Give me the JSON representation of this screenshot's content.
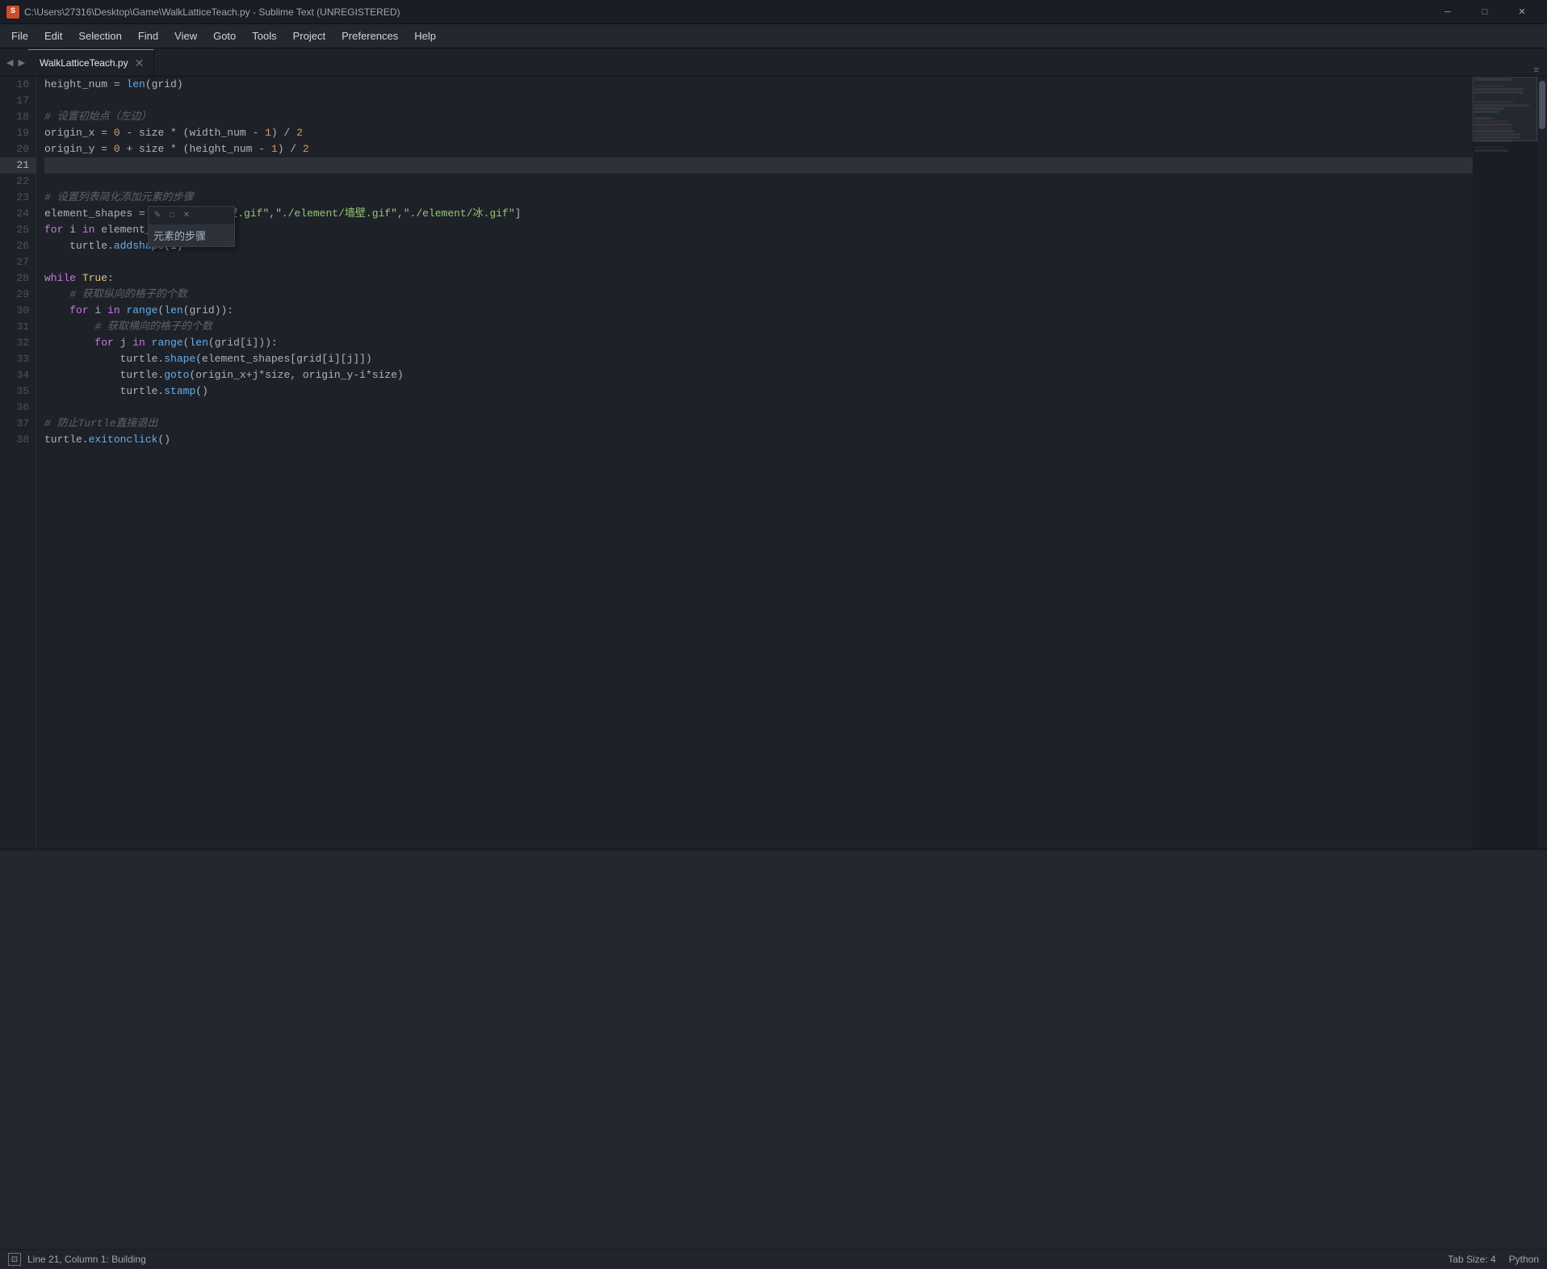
{
  "titlebar": {
    "title": "C:\\Users\\27316\\Desktop\\Game\\WalkLatticeTeach.py - Sublime Text (UNREGISTERED)",
    "icon_color": "#cc4b2c",
    "minimize": "─",
    "maximize": "□",
    "close": "✕"
  },
  "menubar": {
    "items": [
      "File",
      "Edit",
      "Selection",
      "Find",
      "View",
      "Goto",
      "Tools",
      "Project",
      "Preferences",
      "Help"
    ]
  },
  "tabbar": {
    "tab_label": "WalkLatticeTeach.py",
    "close_btn": "✕",
    "arrow_left": "◀",
    "arrow_right": "▶"
  },
  "code": {
    "lines": [
      {
        "num": 16,
        "content": "height_num = len(grid)",
        "active": false
      },
      {
        "num": 17,
        "content": "",
        "active": false
      },
      {
        "num": 18,
        "content": "# 设置初始点（左边）",
        "active": false
      },
      {
        "num": 19,
        "content": "origin_x = 0 - size * (width_num - 1) / 2",
        "active": false
      },
      {
        "num": 20,
        "content": "origin_y = 0 + size * (height_num - 1) / 2",
        "active": false
      },
      {
        "num": 21,
        "content": "",
        "active": true
      },
      {
        "num": 22,
        "content": "",
        "active": false
      },
      {
        "num": 23,
        "content": "# 设置列表简化添加元素的步骤",
        "active": false
      },
      {
        "num": 24,
        "content": "element_shapes = [\"./element/空.gif\",\"./element/墙壁.gif\",\"./element/冰.gif\"]",
        "active": false
      },
      {
        "num": 25,
        "content": "for i in element_shapes:",
        "active": false
      },
      {
        "num": 26,
        "content": "    turtle.addshape(i)",
        "active": false
      },
      {
        "num": 27,
        "content": "",
        "active": false
      },
      {
        "num": 28,
        "content": "while True:",
        "active": false
      },
      {
        "num": 29,
        "content": "    # 获取纵向的格子的个数",
        "active": false
      },
      {
        "num": 30,
        "content": "    for i in range(len(grid)):",
        "active": false
      },
      {
        "num": 31,
        "content": "        # 获取横向的格子的个数",
        "active": false
      },
      {
        "num": 32,
        "content": "        for j in range(len(grid[i])):",
        "active": false
      },
      {
        "num": 33,
        "content": "            turtle.shape(element_shapes[grid[i][j]])",
        "active": false
      },
      {
        "num": 34,
        "content": "            turtle.goto(origin_x+j*size, origin_y-i*size)",
        "active": false
      },
      {
        "num": 35,
        "content": "            turtle.stamp()",
        "active": false
      },
      {
        "num": 36,
        "content": "",
        "active": false
      },
      {
        "num": 37,
        "content": "# 防止Turtle直接退出",
        "active": false
      },
      {
        "num": 38,
        "content": "turtle.exitonclick()",
        "active": false
      }
    ]
  },
  "popup": {
    "title_btns": [
      "✎",
      "□",
      "✕"
    ],
    "text": "元素的步骤"
  },
  "statusbar": {
    "left": {
      "icon": "⊡",
      "position": "Line 21, Column 1: Building"
    },
    "right": {
      "tab_size": "Tab Size: 4",
      "language": "Python"
    }
  }
}
